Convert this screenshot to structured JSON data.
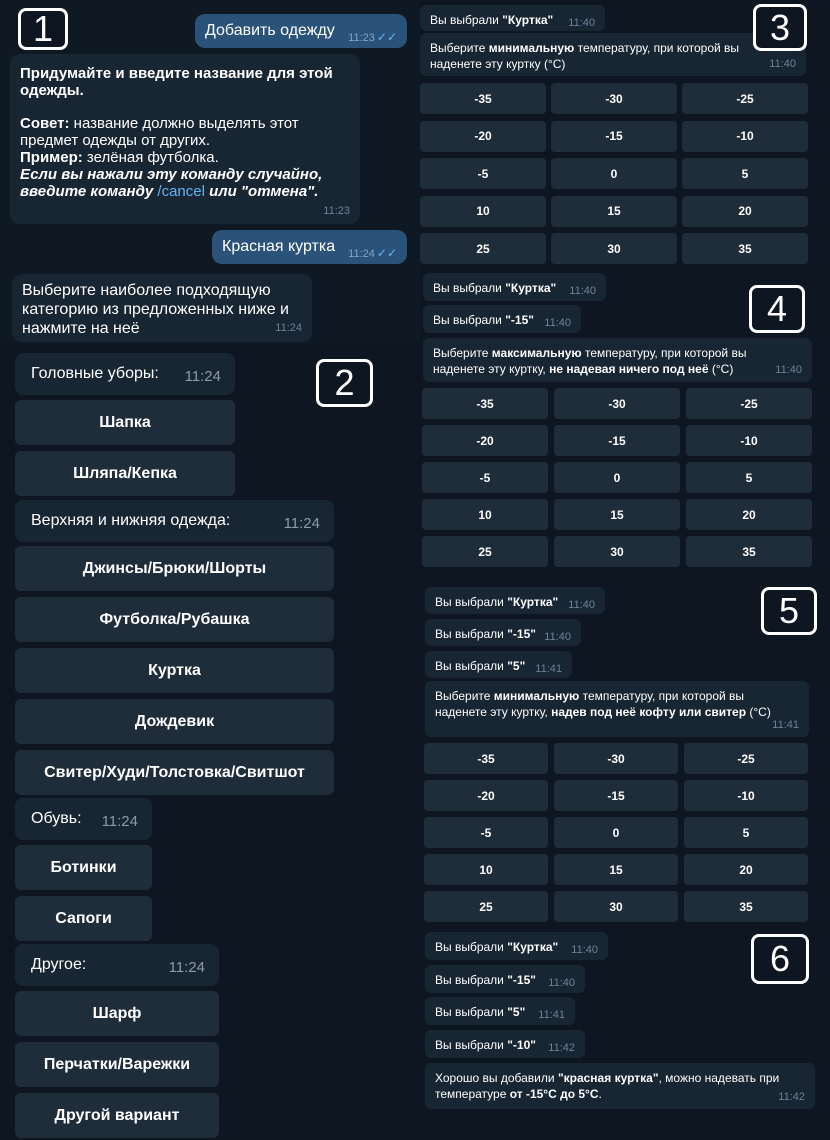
{
  "markers": [
    "1",
    "2",
    "3",
    "4",
    "5",
    "6"
  ],
  "panel1": {
    "out1": {
      "text": "Добавить одежду",
      "time": "11:23",
      "ticks": "✓✓"
    },
    "in1": {
      "line1": "Придумайте и введите название для этой",
      "line2": "одежды.",
      "tip_label": "Совет:",
      "tip_text1": " название должно выделять этот",
      "tip_text2": "предмет одежды от других.",
      "example_label": "Пример:",
      "example_text": " зелёная футболка.",
      "italic1": "Если вы нажали эту команду случайно,",
      "italic2a": "введите команду ",
      "cancel_cmd": "/cancel",
      "italic2b": " или \"отмена\".",
      "time": "11:23"
    },
    "out2": {
      "text": "Красная куртка",
      "time": "11:24",
      "ticks": "✓✓"
    },
    "in2": {
      "line1": "Выберите наиболее подходящую",
      "line2": "категорию из предложенных ниже и",
      "line3": "нажмите на неё",
      "time": "11:24"
    }
  },
  "panel2": {
    "headwear": {
      "label": "Головные уборы:",
      "time": "11:24"
    },
    "hat1": "Шапка",
    "hat2": "Шляпа/Кепка",
    "clothes": {
      "label": "Верхняя и нижняя одежда:",
      "time": "11:24"
    },
    "c1": "Джинсы/Брюки/Шорты",
    "c2": "Футболка/Рубашка",
    "c3": "Куртка",
    "c4": "Дождевик",
    "c5": "Свитер/Худи/Толстовка/Свитшот",
    "shoes": {
      "label": "Обувь:",
      "time": "11:24"
    },
    "s1": "Ботинки",
    "s2": "Сапоги",
    "other": {
      "label": "Другое:",
      "time": "11:24"
    },
    "o1": "Шарф",
    "o2": "Перчатки/Варежки",
    "o3": "Другой вариант"
  },
  "temps": [
    "-35",
    "-30",
    "-25",
    "-20",
    "-15",
    "-10",
    "-5",
    "0",
    "5",
    "10",
    "15",
    "20",
    "25",
    "30",
    "35"
  ],
  "panel3": {
    "chip1": {
      "pre": "Вы выбрали ",
      "val": "\"Куртка\"",
      "time": "11:40"
    },
    "q": {
      "a": "Выберите ",
      "b": "минимальную",
      "c": " температуру, при которой вы",
      "d": "наденете эту куртку (°C)",
      "time": "11:40"
    }
  },
  "panel4": {
    "chip1": {
      "pre": "Вы выбрали ",
      "val": "\"Куртка\"",
      "time": "11:40"
    },
    "chip2": {
      "pre": "Вы выбрали ",
      "val": "\"-15\"",
      "time": "11:40"
    },
    "q": {
      "a": "Выберите ",
      "b": "максимальную",
      "c": " температуру, при которой вы",
      "d": "наденете эту куртку, ",
      "e": "не надевая ничего под неё",
      "f": " (°C)",
      "time": "11:40"
    }
  },
  "panel5": {
    "chip1": {
      "pre": "Вы выбрали ",
      "val": "\"Куртка\"",
      "time": "11:40"
    },
    "chip2": {
      "pre": "Вы выбрали ",
      "val": "\"-15\"",
      "time": "11:40"
    },
    "chip3": {
      "pre": "Вы выбрали ",
      "val": "\"5\"",
      "time": "11:41"
    },
    "q": {
      "a": "Выберите ",
      "b": "минимальную",
      "c": " температуру, при которой вы",
      "d": "наденете эту куртку, ",
      "e": "надев под неё кофту или свитер",
      "f": " (°C)",
      "time": "11:41"
    }
  },
  "panel6": {
    "chip1": {
      "pre": "Вы выбрали ",
      "val": "\"Куртка\"",
      "time": "11:40"
    },
    "chip2": {
      "pre": "Вы выбрали ",
      "val": "\"-15\"",
      "time": "11:40"
    },
    "chip3": {
      "pre": "Вы выбрали ",
      "val": "\"5\"",
      "time": "11:41"
    },
    "chip4": {
      "pre": "Вы выбрали ",
      "val": "\"-10\"",
      "time": "11:42"
    },
    "final": {
      "a": "Хорошо вы добавили ",
      "b": "\"красная куртка\"",
      "c": ", можно надевать при",
      "d": "температуре ",
      "e": "от -15°C до 5°C",
      "f": ".",
      "time": "11:42"
    }
  }
}
